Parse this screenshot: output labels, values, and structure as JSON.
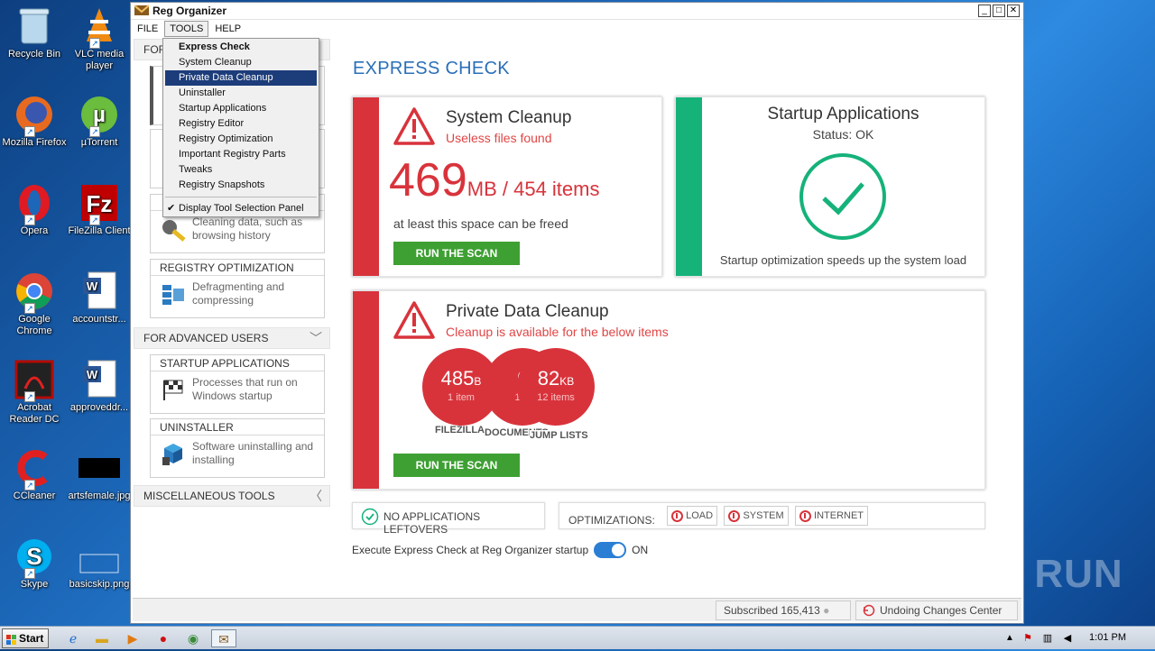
{
  "desktop": {
    "icons": [
      {
        "label": "Recycle Bin",
        "icon": "recycle-bin-icon"
      },
      {
        "label": "VLC media player",
        "icon": "vlc-icon"
      },
      {
        "label": "Mozilla Firefox",
        "icon": "firefox-icon"
      },
      {
        "label": "µTorrent",
        "icon": "utorrent-icon"
      },
      {
        "label": "Opera",
        "icon": "opera-icon"
      },
      {
        "label": "FileZilla Client",
        "icon": "filezilla-icon"
      },
      {
        "label": "Google Chrome",
        "icon": "chrome-icon"
      },
      {
        "label": "accountstr...",
        "icon": "word-doc-icon"
      },
      {
        "label": "Acrobat Reader DC",
        "icon": "acrobat-icon"
      },
      {
        "label": "approveddr...",
        "icon": "word-doc-icon"
      },
      {
        "label": "CCleaner",
        "icon": "ccleaner-icon"
      },
      {
        "label": "artsfemale.jpg",
        "icon": "image-file-icon"
      },
      {
        "label": "Skype",
        "icon": "skype-icon"
      },
      {
        "label": "basicskip.png",
        "icon": "image-file-icon"
      }
    ]
  },
  "window": {
    "title": "Reg Organizer",
    "controls": {
      "minimize": "_",
      "maximize": "□",
      "close": "✕"
    }
  },
  "menu": {
    "file": "FILE",
    "tools": "TOOLS",
    "help": "HELP"
  },
  "dropdown": {
    "items": [
      "Express Check",
      "System Cleanup",
      "Private Data Cleanup",
      "Uninstaller",
      "Startup Applications",
      "Registry Editor",
      "Registry Optimization",
      "Important Registry Parts",
      "Tweaks",
      "Registry Snapshots"
    ],
    "toggle": "Display Tool Selection Panel",
    "check": "✔"
  },
  "sidebar": {
    "hidden_header": "FOR",
    "private_data": {
      "desc": "Cleaning data, such as browsing history"
    },
    "registry_opt": {
      "title": "REGISTRY OPTIMIZATION",
      "desc": "Defragmenting and compressing"
    },
    "advanced_header": "FOR ADVANCED USERS",
    "startup": {
      "title": "STARTUP APPLICATIONS",
      "desc": "Processes that run on Windows startup"
    },
    "uninstaller": {
      "title": "UNINSTALLER",
      "desc": "Software uninstalling and installing"
    },
    "misc_header": "MISCELLANEOUS TOOLS"
  },
  "main": {
    "title": "EXPRESS CHECK",
    "system_cleanup": {
      "title": "System Cleanup",
      "subtitle": "Useless files found",
      "size_number": "469",
      "size_unit": "MB / 454 items",
      "note": "at least this space can be freed",
      "button": "RUN THE SCAN"
    },
    "startup_apps": {
      "title": "Startup Applications",
      "status": "Status: OK",
      "note": "Startup optimization speeds up the system load"
    },
    "private_data": {
      "title": "Private Data Cleanup",
      "subtitle": "Cleanup is available for the below items",
      "bubbles": [
        {
          "value": "485",
          "unit": "B",
          "count": "1 item",
          "label": "FILEZILLA"
        },
        {
          "value": "6",
          "unit": "",
          "count": "11 i",
          "label": "DOCUMENTS"
        },
        {
          "value": "82",
          "unit": "KB",
          "count": "12 items",
          "label": "JUMP LISTS"
        }
      ],
      "button": "RUN THE SCAN"
    },
    "leftovers": "NO APPLICATIONS LEFTOVERS",
    "optimizations": {
      "label": "OPTIMIZATIONS:",
      "items": [
        "LOAD",
        "SYSTEM",
        "INTERNET"
      ]
    },
    "startup_toggle": {
      "label": "Execute Express Check at Reg Organizer startup",
      "state": "ON"
    }
  },
  "status": {
    "subscribed": "Subscribed 165,413",
    "undo": "Undoing Changes Center"
  },
  "taskbar": {
    "start": "Start",
    "time": "1:01 PM"
  },
  "watermark": "ANY RUN",
  "colors": {
    "accent_blue": "#2a6fb8",
    "red": "#d8333b",
    "green": "#3ea033",
    "teal": "#15b27a"
  }
}
